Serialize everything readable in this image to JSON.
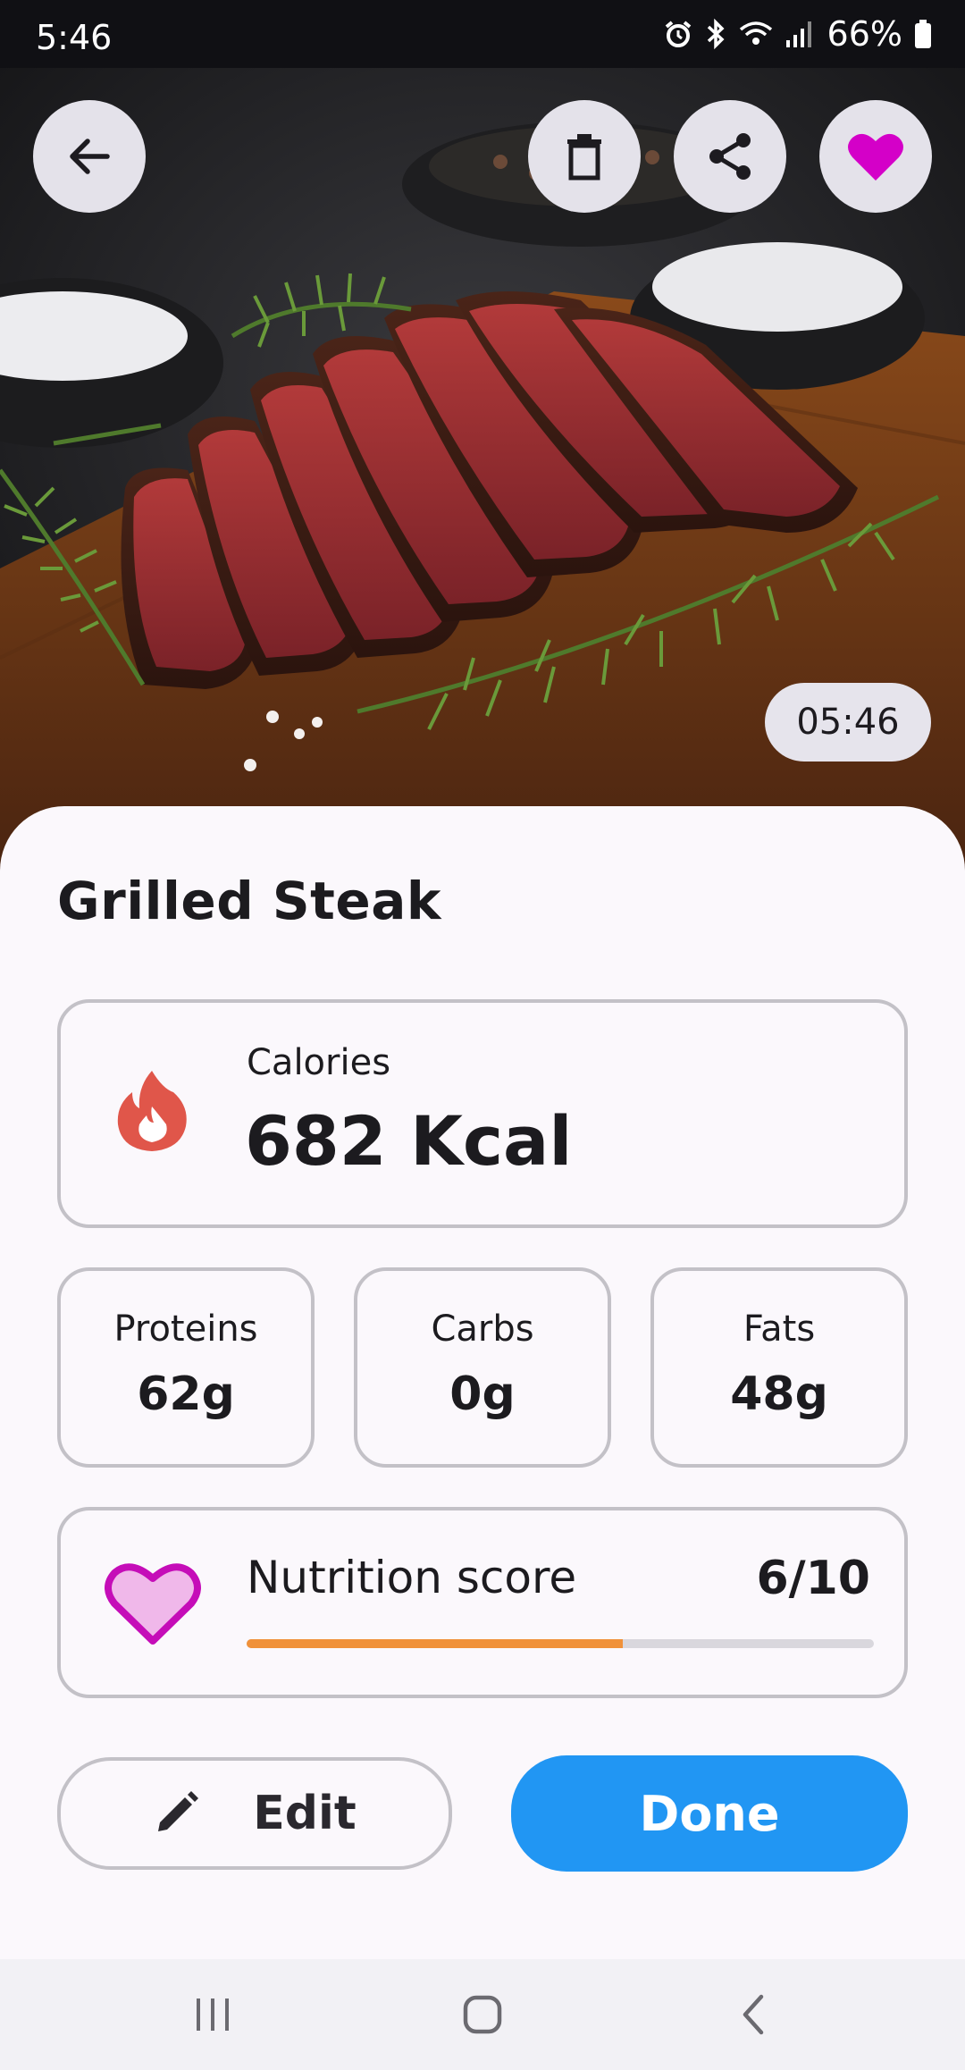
{
  "status_bar": {
    "time": "5:46",
    "battery": "66%"
  },
  "hero": {
    "image_alt": "Sliced grilled steak on a wooden board with rosemary and salt",
    "timer": "05:46"
  },
  "actions": {
    "back_icon": "arrow-left-icon",
    "delete_icon": "trash-icon",
    "share_icon": "share-icon",
    "favorite_icon": "heart-icon"
  },
  "meal": {
    "title": "Grilled Steak",
    "calories": {
      "label": "Calories",
      "value": "682 Kcal"
    },
    "macros": [
      {
        "label": "Proteins",
        "value": "62g"
      },
      {
        "label": "Carbs",
        "value": "0g"
      },
      {
        "label": "Fats",
        "value": "48g"
      }
    ],
    "nutrition": {
      "label": "Nutrition score",
      "value": "6/10",
      "fraction": 0.6
    }
  },
  "buttons": {
    "edit": "Edit",
    "done": "Done"
  },
  "colors": {
    "accent": "#2196f3",
    "score_bar": "#f0913a",
    "heart": "#d400c8",
    "flame": "#e0564a"
  }
}
